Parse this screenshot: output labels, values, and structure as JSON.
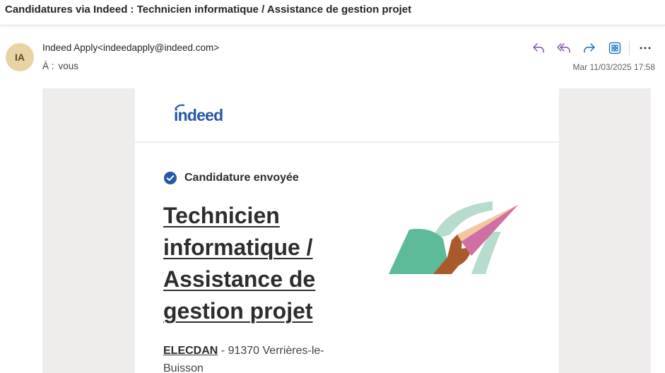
{
  "email": {
    "subject": "Candidatures via Indeed : Technicien informatique / Assistance de gestion projet",
    "avatar_initials": "IA",
    "sender": "Indeed Apply<indeedapply@indeed.com>",
    "to_label": "À :",
    "to_value": "vous",
    "date": "Mar 11/03/2025 17:58",
    "actions": [
      "reply-icon",
      "reply-all-icon",
      "forward-icon",
      "apps-icon",
      "more-icon"
    ]
  },
  "body": {
    "logo_text": "indeed",
    "status": "Candidature envoyée",
    "job_title": "Technicien informatique / Assistance de gestion projet",
    "company": "ELECDAN",
    "location": " - 91370 Verrières-le-Buisson"
  },
  "colors": {
    "accent": "#7b4fa3",
    "blue_action": "#0f6cbd",
    "indeed_blue": "#2557a7",
    "check_blue": "#2557a7"
  }
}
